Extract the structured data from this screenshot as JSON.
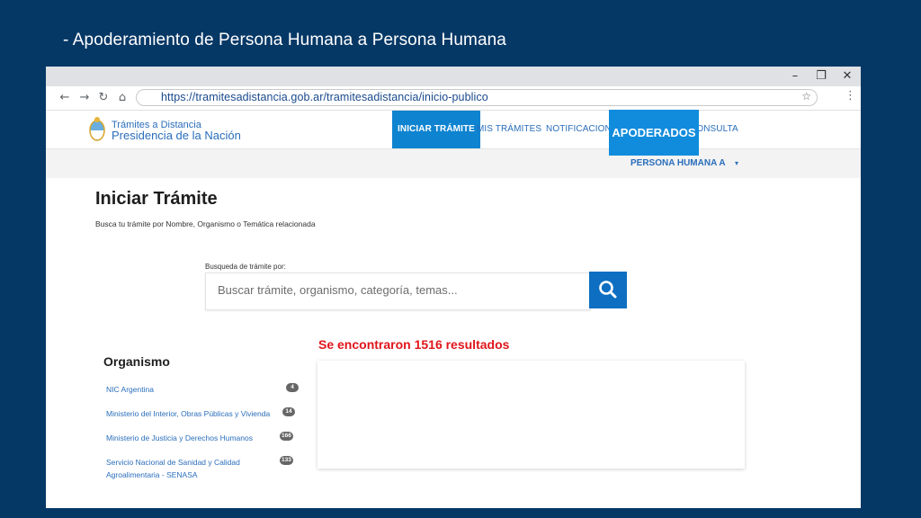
{
  "slide": {
    "title": "- Apoderamiento de Persona Humana a Persona Humana"
  },
  "window": {
    "minimize": "–",
    "restore": "❐",
    "close": "✕"
  },
  "browser": {
    "back": "←",
    "forward": "→",
    "reload": "↻",
    "home": "⌂",
    "url": "https://tramitesadistancia.gob.ar/tramitesadistancia/inicio-publico",
    "star": "☆",
    "menu": "⋮"
  },
  "header": {
    "logo_line1": "Trámites a Distancia",
    "logo_line2": "Presidencia de la Nación",
    "nav": [
      "INICIAR TRÁMITE",
      "MIS TRÁMITES",
      "NOTIFICACIONES",
      "CONSULTA"
    ],
    "callout": "APODERADOS",
    "persona": "PERSONA HUMANA A"
  },
  "main": {
    "title": "Iniciar Trámite",
    "subtitle": "Busca tu trámite por Nombre, Organismo o Temática relacionada",
    "search_label": "Busqueda de trámite por:",
    "search_placeholder": "Buscar trámite, organismo, categoría, temas...",
    "results": "Se encontraron 1516 resultados"
  },
  "sidebar": {
    "title": "Organismo",
    "items": [
      {
        "label": "NIC Argentina",
        "count": "4"
      },
      {
        "label": "Ministerio del Interior, Obras Públicas y Vivienda",
        "count": "14"
      },
      {
        "label": "Ministerio de Justicia y Derechos Humanos",
        "count": "166"
      },
      {
        "label": "Servicio Nacional de Sanidad y Calidad Agroalimentaria - SENASA",
        "count": "133"
      }
    ]
  },
  "colors": {
    "slide_bg": "#063866",
    "accent": "#0e83d0",
    "link": "#2a6ebb",
    "results": "#e0151b"
  }
}
